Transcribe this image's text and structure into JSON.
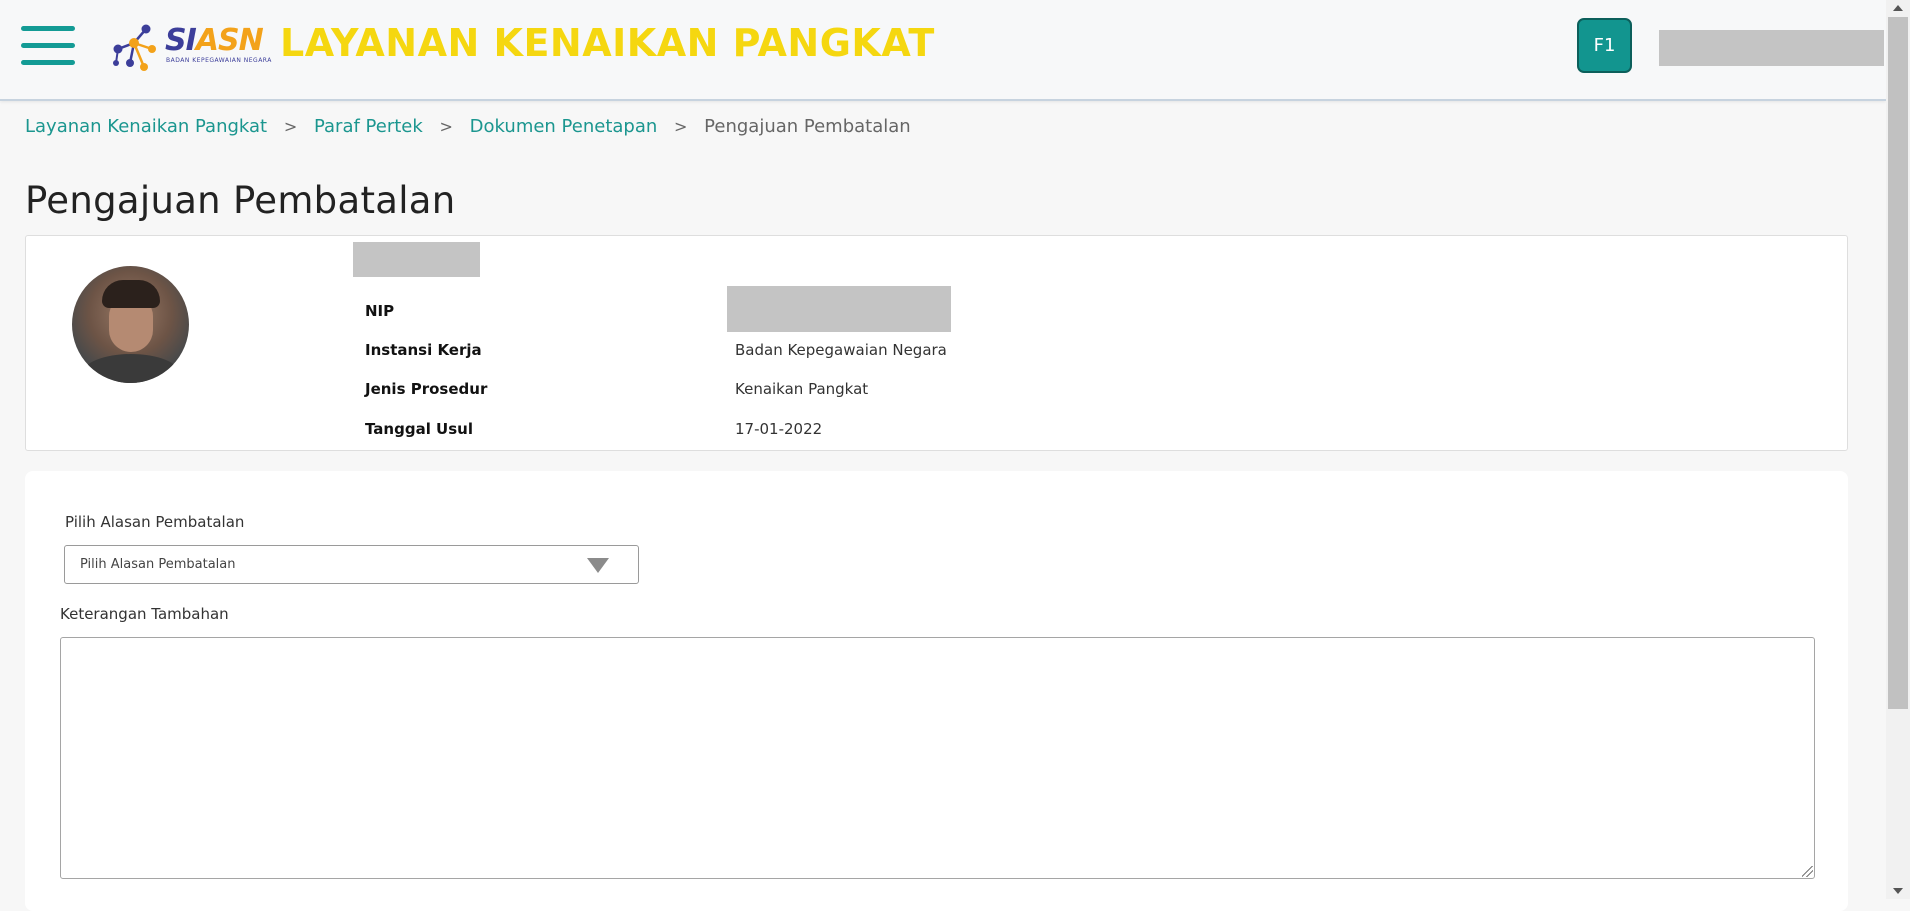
{
  "header": {
    "logo": {
      "brand_si": "SI",
      "brand_asn": "ASN",
      "subtitle": "BADAN KEPEGAWAIAN NEGARA"
    },
    "title": "LAYANAN KENAIKAN PANGKAT",
    "user_badge": "F1",
    "icons": {
      "menu": "hamburger-menu-icon"
    }
  },
  "breadcrumb": {
    "items": [
      "Layanan Kenaikan Pangkat",
      "Paraf Pertek",
      "Dokumen Penetapan"
    ],
    "current": "Pengajuan Pembatalan",
    "separator": ">"
  },
  "page": {
    "title": "Pengajuan Pembatalan"
  },
  "profile": {
    "fields": [
      {
        "label": "NIP",
        "value": ""
      },
      {
        "label": "Instansi Kerja",
        "value": "Badan Kepegawaian Negara"
      },
      {
        "label": "Jenis Prosedur",
        "value": "Kenaikan Pangkat"
      },
      {
        "label": "Tanggal Usul",
        "value": "17-01-2022"
      }
    ]
  },
  "form": {
    "reason_label": "Pilih Alasan Pembatalan",
    "reason_select_value": "Pilih Alasan Pembatalan",
    "notes_label": "Keterangan Tambahan",
    "notes_value": ""
  },
  "colors": {
    "accent": "#139b95",
    "title_yellow": "#f5d710",
    "brand_blue": "#3c3e9a",
    "brand_orange": "#f3a21a"
  }
}
